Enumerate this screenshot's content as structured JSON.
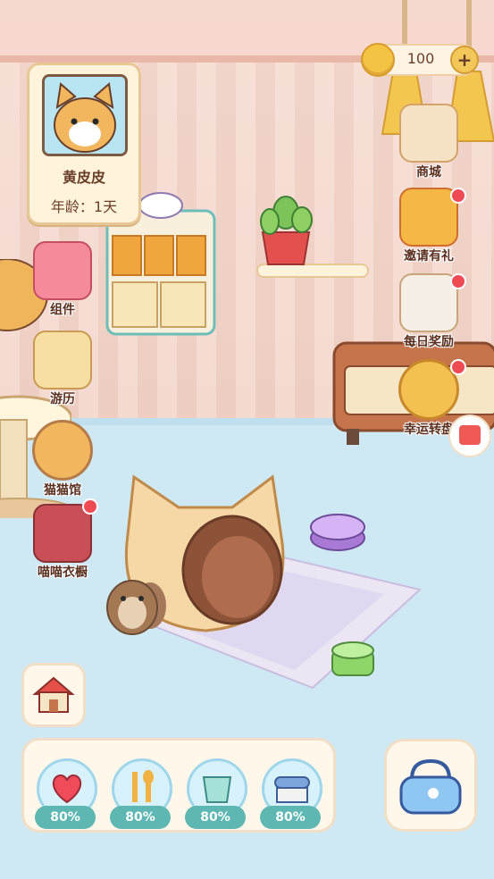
{
  "profile": {
    "name": "黄皮皮",
    "age": "年龄：1天"
  },
  "currency": {
    "amount": "100",
    "plus": "+"
  },
  "right_menu": [
    {
      "label": "商城",
      "icon": "shop-icon",
      "badge": false
    },
    {
      "label": "邀请有礼",
      "icon": "gift-box-icon",
      "badge": true
    },
    {
      "label": "每日奖励",
      "icon": "calendar-icon",
      "badge": true
    },
    {
      "label": "幸运转盘",
      "icon": "wheel-icon",
      "badge": true
    }
  ],
  "left_menu": [
    {
      "label": "组件",
      "icon": "component-box-icon",
      "badge": false
    },
    {
      "label": "游历",
      "icon": "map-icon",
      "badge": false
    },
    {
      "label": "猫猫馆",
      "icon": "cat-hall-icon",
      "badge": false
    },
    {
      "label": "喵喵衣橱",
      "icon": "wardrobe-icon",
      "badge": true
    }
  ],
  "stats": [
    {
      "name": "mood",
      "icon": "heart-icon",
      "value": "80%"
    },
    {
      "name": "food",
      "icon": "fork-spoon-icon",
      "value": "80%"
    },
    {
      "name": "water",
      "icon": "cup-icon",
      "value": "80%"
    },
    {
      "name": "clean",
      "icon": "brush-icon",
      "value": "80%"
    }
  ],
  "colors": {
    "accent": "#5fb7b4",
    "badge": "#ef4b55",
    "text": "#5a2f1f",
    "panel": "#fff7ea"
  }
}
